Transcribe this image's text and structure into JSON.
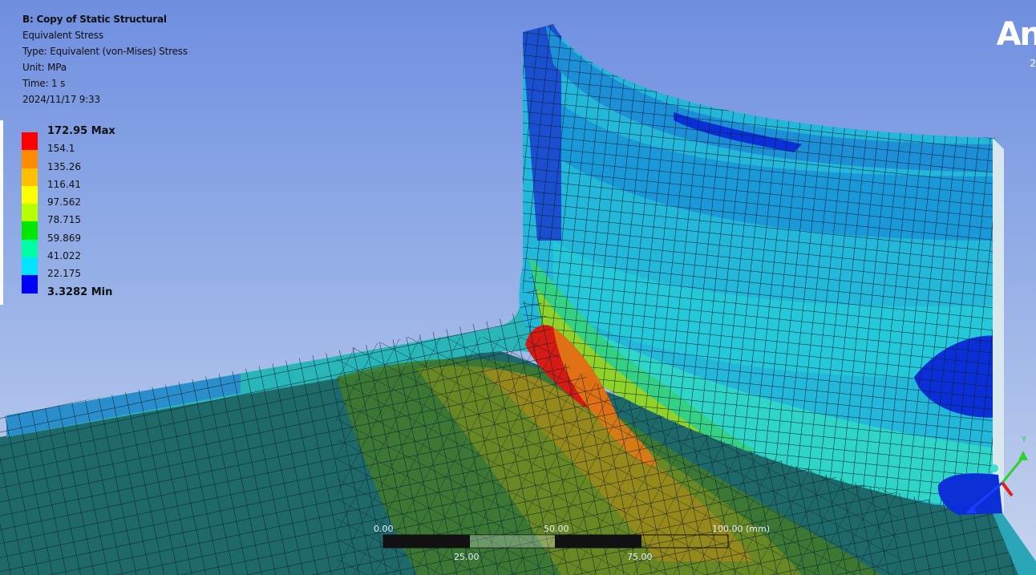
{
  "analysis": {
    "title": "B: Copy of Static Structural",
    "result_name": "Equivalent Stress",
    "type": "Type: Equivalent (von-Mises) Stress",
    "unit": "Unit: MPa",
    "time": "Time: 1 s",
    "timestamp": "2024/11/17 9:33"
  },
  "legend": {
    "entries": [
      {
        "label": "172.95 Max",
        "bold": true,
        "color": "#ff0000"
      },
      {
        "label": "154.1",
        "bold": false,
        "color": "#ff8c00"
      },
      {
        "label": "135.26",
        "bold": false,
        "color": "#ffc000"
      },
      {
        "label": "116.41",
        "bold": false,
        "color": "#ffff00"
      },
      {
        "label": "97.562",
        "bold": false,
        "color": "#b6ff00"
      },
      {
        "label": "78.715",
        "bold": false,
        "color": "#00e800"
      },
      {
        "label": "59.869",
        "bold": false,
        "color": "#00ffa4"
      },
      {
        "label": "41.022",
        "bold": false,
        "color": "#00e4ff"
      },
      {
        "label": "22.175",
        "bold": false,
        "color": "#0094ff"
      },
      {
        "label": "3.3282 Min",
        "bold": true,
        "color": "#0000ff"
      }
    ]
  },
  "branding": {
    "logo_text": "An",
    "logo_sub": "2"
  },
  "scale_bar": {
    "label_0": "0.00",
    "label_25": "25.00",
    "label_50": "50.00",
    "label_75": "75.00",
    "label_100": "100.00 (mm)"
  },
  "triad": {
    "y_label": "Y"
  },
  "colors": {
    "background_top": "#6f8ee0",
    "background_bottom": "#c8d4ee",
    "mesh_line": "#0c1e2a"
  }
}
